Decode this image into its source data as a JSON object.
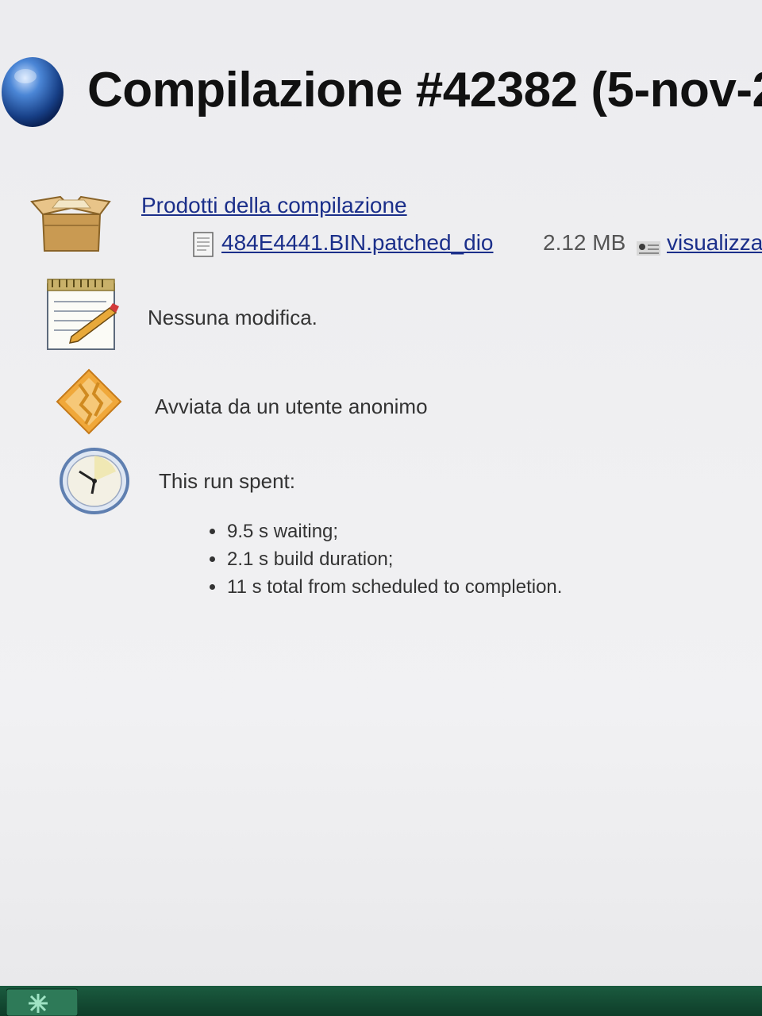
{
  "header": {
    "title": "Compilazione #42382 (5-nov-2",
    "status_icon": "blue-ball-icon"
  },
  "artifacts": {
    "heading": "Prodotti della compilazione",
    "files": [
      {
        "name": "484E4441.BIN.patched_dio",
        "size": "2.12 MB",
        "view_label": "visualizza"
      }
    ]
  },
  "changes": {
    "text": "Nessuna modifica."
  },
  "cause": {
    "text": "Avviata da un utente anonimo"
  },
  "timing": {
    "heading": "This run spent:",
    "items": [
      "9.5 s waiting;",
      "2.1 s build duration;",
      "11 s total from scheduled to completion."
    ]
  },
  "colors": {
    "link": "#1b2f8a",
    "status_ball": "#2a64b8",
    "taskbar": "#145036"
  }
}
